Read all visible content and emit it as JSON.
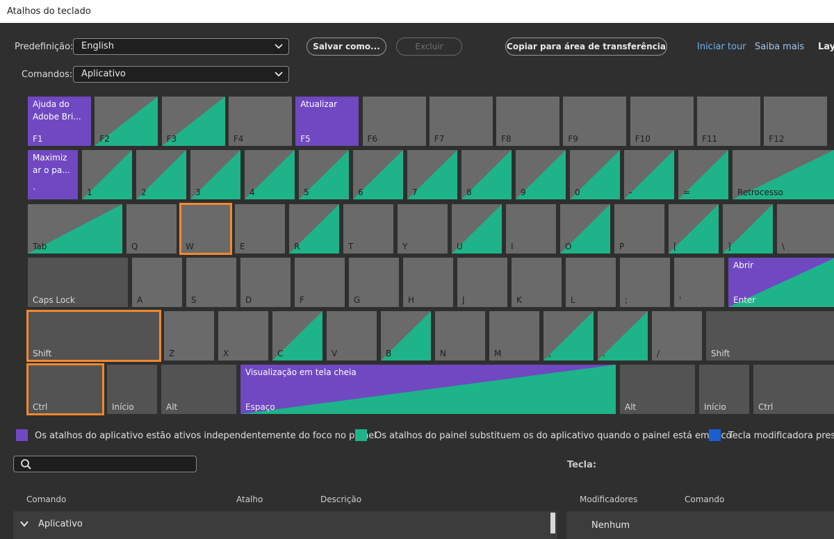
{
  "window": {
    "title": "Atalhos do teclado"
  },
  "toolbar": {
    "preset_label": "Predefinição:",
    "preset_value": "English",
    "commands_label": "Comandos:",
    "commands_value": "Aplicativo",
    "save_as": "Salvar como...",
    "delete": "Excluir",
    "copy_clipboard": "Copiar para área de transferência",
    "start_tour": "Iniciar tour",
    "learn_more": "Saiba mais",
    "layout_cut": "Lay"
  },
  "colors": {
    "purple": "#7048c2",
    "green": "#1fb389",
    "blue": "#1a5fd1",
    "key_gray": "#6a6a6a",
    "mod_gray": "#535353",
    "highlight": "#f2892e"
  },
  "keyboard": {
    "rows": [
      [
        {
          "label": "F1",
          "style": "purple",
          "command": "Ajuda do\nAdobe Bri..."
        },
        {
          "label": "F2",
          "style": "green_tri"
        },
        {
          "label": "F3",
          "style": "green_tri"
        },
        {
          "label": "F4",
          "style": "gray"
        },
        {
          "label": "F5",
          "style": "purple",
          "command": "Atualizar"
        },
        {
          "label": "F6",
          "style": "gray"
        },
        {
          "label": "F7",
          "style": "gray"
        },
        {
          "label": "F8",
          "style": "gray"
        },
        {
          "label": "F9",
          "style": "gray"
        },
        {
          "label": "F10",
          "style": "gray"
        },
        {
          "label": "F11",
          "style": "gray"
        },
        {
          "label": "F12",
          "style": "gray"
        }
      ],
      [
        {
          "label": "`",
          "style": "purple",
          "command": "Maximiz\nar o pa..."
        },
        {
          "label": "1",
          "style": "green_tri"
        },
        {
          "label": "2",
          "style": "green_tri"
        },
        {
          "label": "3",
          "style": "green_tri"
        },
        {
          "label": "4",
          "style": "green_tri"
        },
        {
          "label": "5",
          "style": "green_tri"
        },
        {
          "label": "6",
          "style": "green_tri"
        },
        {
          "label": "7",
          "style": "green_tri"
        },
        {
          "label": "8",
          "style": "green_tri"
        },
        {
          "label": "9",
          "style": "green_tri"
        },
        {
          "label": "0",
          "style": "green_tri"
        },
        {
          "label": "-",
          "style": "green_tri"
        },
        {
          "label": "=",
          "style": "green_tri"
        },
        {
          "label": "Retrocesso",
          "style": "green_tri"
        }
      ],
      [
        {
          "label": "Tab",
          "style": "green_tri"
        },
        {
          "label": "Q",
          "style": "gray"
        },
        {
          "label": "W",
          "style": "gray",
          "highlight": true
        },
        {
          "label": "E",
          "style": "gray"
        },
        {
          "label": "R",
          "style": "green_tri"
        },
        {
          "label": "T",
          "style": "gray"
        },
        {
          "label": "Y",
          "style": "gray"
        },
        {
          "label": "U",
          "style": "green_tri"
        },
        {
          "label": "I",
          "style": "gray"
        },
        {
          "label": "O",
          "style": "green_tri"
        },
        {
          "label": "P",
          "style": "gray"
        },
        {
          "label": "[",
          "style": "green_tri"
        },
        {
          "label": "]",
          "style": "green_tri"
        },
        {
          "label": "\\",
          "style": "gray"
        }
      ],
      [
        {
          "label": "Caps Lock",
          "style": "mod"
        },
        {
          "label": "A",
          "style": "gray"
        },
        {
          "label": "S",
          "style": "gray"
        },
        {
          "label": "D",
          "style": "gray"
        },
        {
          "label": "F",
          "style": "gray"
        },
        {
          "label": "G",
          "style": "gray"
        },
        {
          "label": "H",
          "style": "gray"
        },
        {
          "label": "J",
          "style": "gray"
        },
        {
          "label": "K",
          "style": "gray"
        },
        {
          "label": "L",
          "style": "gray"
        },
        {
          "label": ";",
          "style": "gray"
        },
        {
          "label": "'",
          "style": "gray"
        },
        {
          "label": "Enter",
          "style": "purple_green",
          "command": "Abrir"
        }
      ],
      [
        {
          "label": "Shift",
          "style": "mod",
          "highlight": true
        },
        {
          "label": "Z",
          "style": "gray"
        },
        {
          "label": "X",
          "style": "gray"
        },
        {
          "label": "C",
          "style": "green_tri"
        },
        {
          "label": "V",
          "style": "gray"
        },
        {
          "label": "B",
          "style": "green_tri"
        },
        {
          "label": "N",
          "style": "gray"
        },
        {
          "label": "M",
          "style": "gray"
        },
        {
          "label": ",",
          "style": "green_tri"
        },
        {
          "label": ".",
          "style": "green_tri"
        },
        {
          "label": "/",
          "style": "gray"
        },
        {
          "label": "Shift",
          "style": "mod"
        }
      ],
      [
        {
          "label": "Ctrl",
          "style": "mod",
          "highlight": true
        },
        {
          "label": "Início",
          "style": "mod"
        },
        {
          "label": "Alt",
          "style": "mod"
        },
        {
          "label": "Espaço",
          "style": "purple_green",
          "command": "Visualização em tela cheia"
        },
        {
          "label": "Alt",
          "style": "mod"
        },
        {
          "label": "Início",
          "style": "mod"
        },
        {
          "label": "Ctrl",
          "style": "mod"
        }
      ]
    ]
  },
  "legend": [
    {
      "color": "#7048c2",
      "text": "Os atalhos do aplicativo estão ativos independentemente do foco no painel"
    },
    {
      "color": "#1fb389",
      "text": "Os atalhos do painel substituem os do aplicativo quando o painel está em foco"
    },
    {
      "color": "#1a5fd1",
      "text": "Tecla modificadora pressi"
    }
  ],
  "search": {
    "placeholder": ""
  },
  "key_panel": {
    "label": "Tecla:"
  },
  "table": {
    "headers": [
      "Comando",
      "Atalho",
      "Descrição"
    ],
    "group": "Aplicativo"
  },
  "modifiers_table": {
    "headers": [
      "Modificadores",
      "Comando"
    ],
    "first_row": "Nenhum"
  }
}
